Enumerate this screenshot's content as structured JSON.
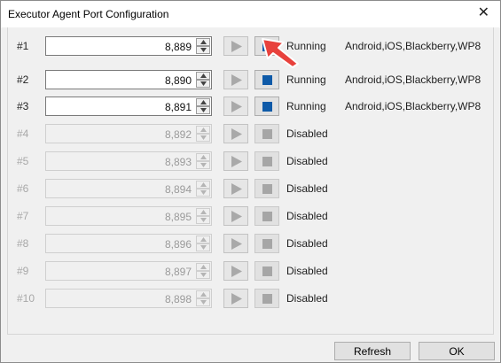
{
  "window": {
    "title": "Executor Agent Port Configuration",
    "close_symbol": "✕"
  },
  "rows": [
    {
      "label": "#1",
      "port": "8,889",
      "status": "Running",
      "platforms": "Android,iOS,Blackberry,WP8",
      "enabled": true
    },
    {
      "label": "#2",
      "port": "8,890",
      "status": "Running",
      "platforms": "Android,iOS,Blackberry,WP8",
      "enabled": true
    },
    {
      "label": "#3",
      "port": "8,891",
      "status": "Running",
      "platforms": "Android,iOS,Blackberry,WP8",
      "enabled": true
    },
    {
      "label": "#4",
      "port": "8,892",
      "status": "Disabled",
      "platforms": "",
      "enabled": false
    },
    {
      "label": "#5",
      "port": "8,893",
      "status": "Disabled",
      "platforms": "",
      "enabled": false
    },
    {
      "label": "#6",
      "port": "8,894",
      "status": "Disabled",
      "platforms": "",
      "enabled": false
    },
    {
      "label": "#7",
      "port": "8,895",
      "status": "Disabled",
      "platforms": "",
      "enabled": false
    },
    {
      "label": "#8",
      "port": "8,896",
      "status": "Disabled",
      "platforms": "",
      "enabled": false
    },
    {
      "label": "#9",
      "port": "8,897",
      "status": "Disabled",
      "platforms": "",
      "enabled": false
    },
    {
      "label": "#10",
      "port": "8,898",
      "status": "Disabled",
      "platforms": "",
      "enabled": false
    }
  ],
  "buttons": {
    "refresh_label": "Refresh",
    "ok_label": "OK"
  },
  "colors": {
    "stop_active": "#0e5aa8",
    "stop_disabled": "#a6a6a6",
    "cursor_arrow": "#e8413c"
  },
  "icons": {
    "play": "play-icon",
    "stop": "stop-icon",
    "spin_up": "chevron-up-icon",
    "spin_down": "chevron-down-icon",
    "close": "close-icon",
    "cursor": "pointer-arrow-icon"
  }
}
